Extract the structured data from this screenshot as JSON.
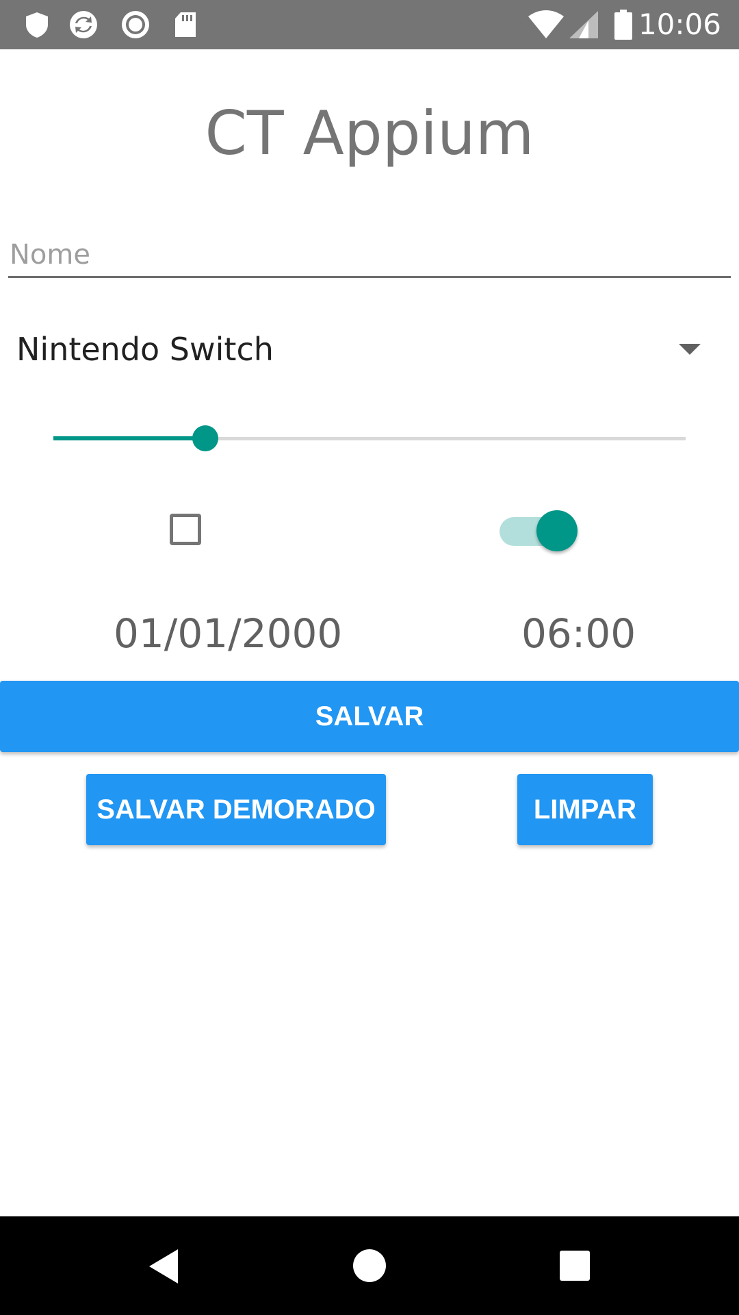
{
  "status_bar": {
    "time": "10:06",
    "left_icons": [
      "shield-icon",
      "sync-icon",
      "record-icon",
      "sd-card-icon"
    ],
    "right_icons": [
      "wifi-icon",
      "signal-icon",
      "battery-icon"
    ]
  },
  "app": {
    "title": "CT Appium"
  },
  "form": {
    "name_placeholder": "Nome",
    "name_value": "",
    "console_selected": "Nintendo Switch",
    "seekbar_fraction": 0.24,
    "checkbox_checked": false,
    "switch_on": true,
    "date": "01/01/2000",
    "time": "06:00"
  },
  "buttons": {
    "save": "SALVAR",
    "save_delayed": "SALVAR DEMORADO",
    "clear": "LIMPAR"
  },
  "colors": {
    "status_bar": "#757575",
    "accent": "#009688",
    "accent_light": "#b2dfdb",
    "button": "#2196f3",
    "nav_bar": "#000000"
  }
}
